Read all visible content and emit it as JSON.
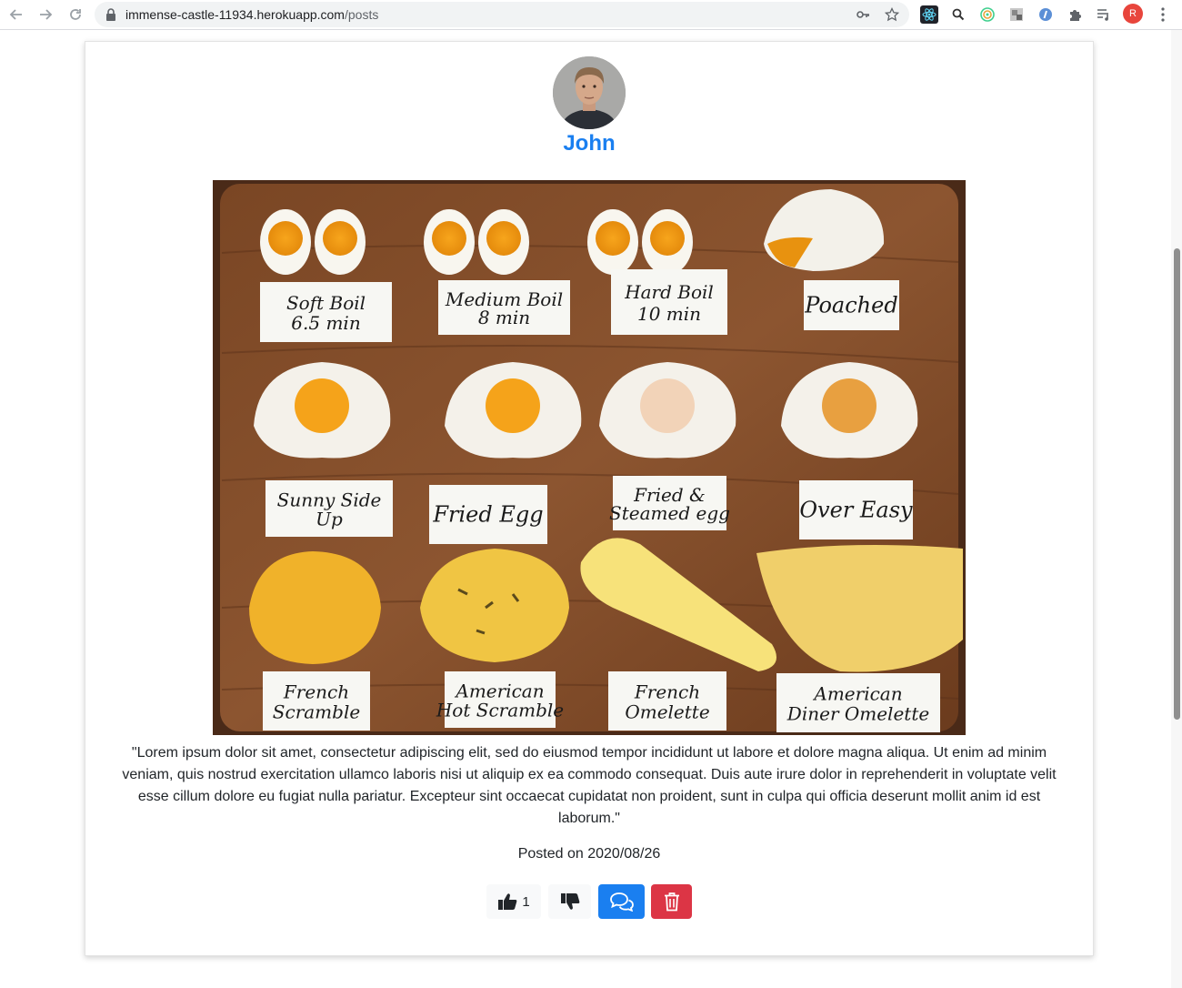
{
  "browser": {
    "url_host": "immense-castle-11934.herokuapp.com",
    "url_path": "/posts",
    "profile_initial": "R"
  },
  "post": {
    "author": "John",
    "photo_labels": [
      [
        "Soft Boil",
        "6.5 min"
      ],
      [
        "Medium Boil",
        "8 min"
      ],
      [
        "Hard Boil",
        "10 min"
      ],
      [
        "Poached"
      ],
      [
        "Sunny Side",
        "Up"
      ],
      [
        "Fried Egg"
      ],
      [
        "Fried &",
        "Steamed egg"
      ],
      [
        "Over Easy"
      ],
      [
        "French",
        "Scramble"
      ],
      [
        "American",
        "Hot Scramble"
      ],
      [
        "French",
        "Omelette"
      ],
      [
        "American",
        "Diner Omelette"
      ]
    ],
    "body": "\"Lorem ipsum dolor sit amet, consectetur adipiscing elit, sed do eiusmod tempor incididunt ut labore et dolore magna aliqua. Ut enim ad minim veniam, quis nostrud exercitation ullamco laboris nisi ut aliquip ex ea commodo consequat. Duis aute irure dolor in reprehenderit in voluptate velit esse cillum dolore eu fugiat nulla pariatur. Excepteur sint occaecat cupidatat non proident, sunt in culpa qui officia deserunt mollit anim id est laborum.\"",
    "date_prefix": "Posted on",
    "date": "2020/08/26",
    "likes": "1"
  },
  "colors": {
    "primary": "#1a7ff0",
    "danger": "#dc3545",
    "light": "#f8f9fa"
  },
  "icons": {
    "like": "thumbs-up-icon",
    "dislike": "thumbs-down-icon",
    "comment": "comments-icon",
    "delete": "trash-icon"
  }
}
